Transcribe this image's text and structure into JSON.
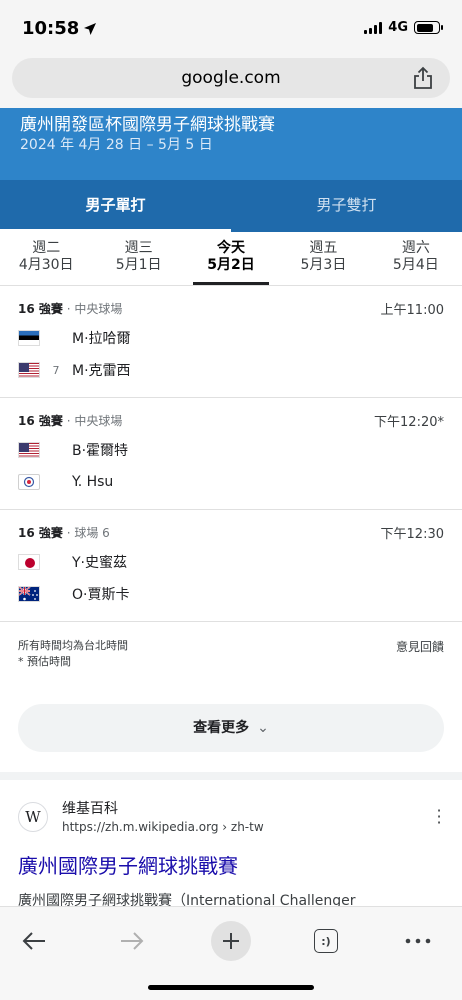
{
  "status": {
    "time": "10:58",
    "network": "4G"
  },
  "browser": {
    "url": "google.com"
  },
  "tournament": {
    "title": "廣州開發區杯國際男子網球挑戰賽",
    "dates": "2024 年 4月 28 日 – 5月 5 日"
  },
  "tabs": [
    {
      "label": "男子單打",
      "active": true
    },
    {
      "label": "男子雙打",
      "active": false
    }
  ],
  "days": [
    {
      "name": "週二",
      "date": "4月30日"
    },
    {
      "name": "週三",
      "date": "5月1日"
    },
    {
      "name": "今天",
      "date": "5月2日",
      "active": true
    },
    {
      "name": "週五",
      "date": "5月3日"
    },
    {
      "name": "週六",
      "date": "5月4日"
    }
  ],
  "matches": [
    {
      "round": "16 強賽",
      "court": "· 中央球場",
      "time": "上午11:00",
      "players": [
        {
          "name": "M·拉哈爾",
          "seed": "",
          "flag": "estonia-flag-icon"
        },
        {
          "name": "M·克雷西",
          "seed": "7",
          "flag": "usa-flag-icon"
        }
      ]
    },
    {
      "round": "16 強賽",
      "court": "· 中央球場",
      "time": "下午12:20*",
      "players": [
        {
          "name": "B·霍爾特",
          "seed": "",
          "flag": "usa-flag-icon"
        },
        {
          "name": "Y. Hsu",
          "seed": "",
          "flag": "chinese-taipei-flag-icon"
        }
      ]
    },
    {
      "round": "16 強賽",
      "court": "· 球場 6",
      "time": "下午12:30",
      "players": [
        {
          "name": "Y·史蜜茲",
          "seed": "",
          "flag": "japan-flag-icon"
        },
        {
          "name": "O·賈斯卡",
          "seed": "",
          "flag": "australia-flag-icon"
        }
      ]
    }
  ],
  "footer": {
    "timezone_note": "所有時間均為台北時間",
    "estimate_note": "* 預估時間",
    "feedback": "意見回饋",
    "more_label": "查看更多"
  },
  "result": {
    "site": "维基百科",
    "url": "https://zh.m.wikipedia.org › zh-tw",
    "title": "廣州國際男子網球挑戰賽",
    "snippet": "廣州國際男子網球挑戰賽（International Challenger",
    "icon_letter": "W"
  },
  "toolbar": {
    "tabs_label": ":)"
  }
}
